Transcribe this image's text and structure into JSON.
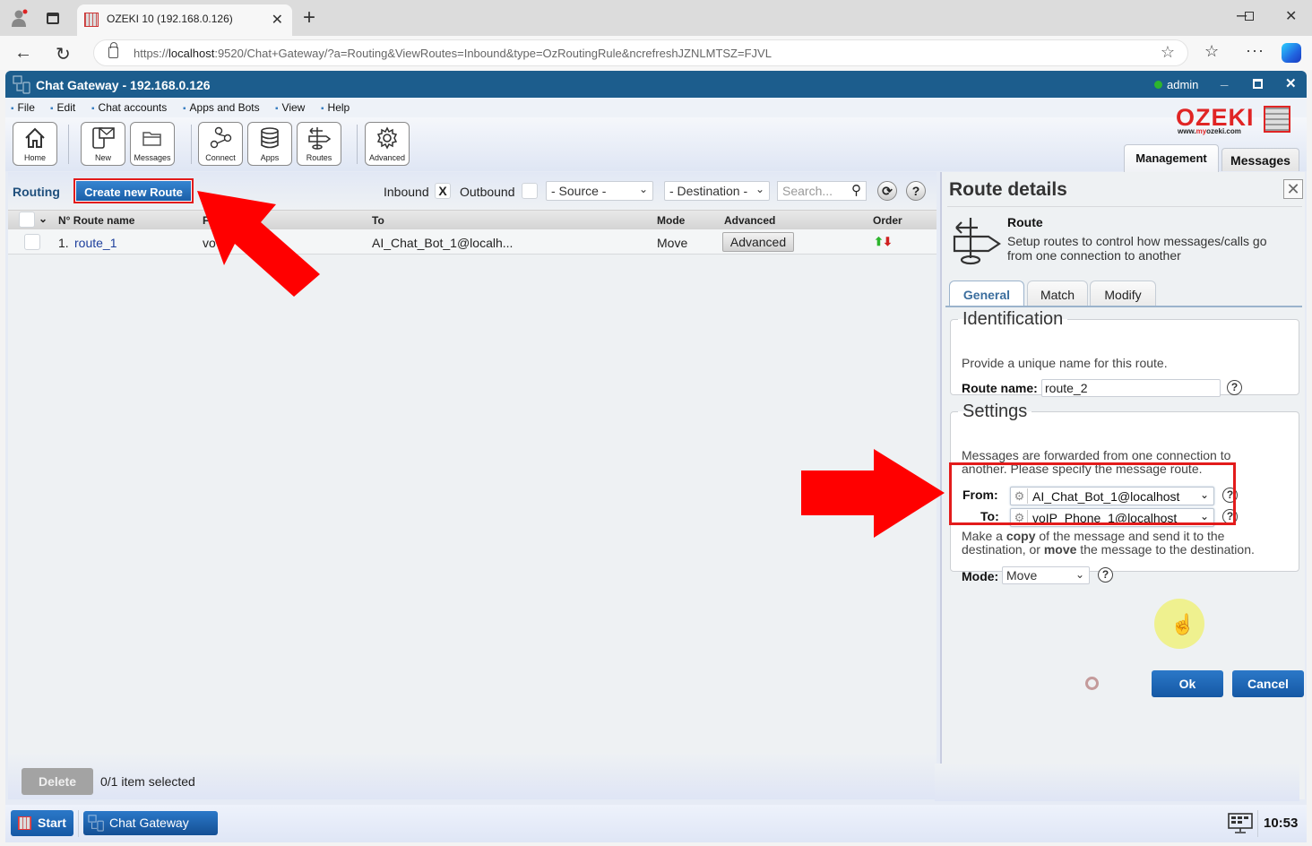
{
  "browser": {
    "tab_title": "OZEKI 10 (192.168.0.126)",
    "url_prefix": "https://",
    "url_host": "localhost",
    "url_rest": ":9520/Chat+Gateway/?a=Routing&ViewRoutes=Inbound&type=OzRoutingRule&ncrefreshJZNLMTSZ=FJVL"
  },
  "app": {
    "title": "Chat Gateway - 192.168.0.126",
    "user": "admin",
    "menu": [
      "File",
      "Edit",
      "Chat accounts",
      "Apps and Bots",
      "View",
      "Help"
    ],
    "toolbar": [
      "Home",
      "New",
      "Messages",
      "Connect",
      "Apps",
      "Routes",
      "Advanced"
    ],
    "logo_word": "OZEKI",
    "logo_url_pre": "www.",
    "logo_url_my": "my",
    "logo_url_post": "ozeki.com",
    "main_tabs": [
      "Management",
      "Messages"
    ]
  },
  "routing": {
    "label": "Routing",
    "create_button": "Create new Route",
    "filter_inbound": "Inbound",
    "filter_inbound_checked": "X",
    "filter_outbound": "Outbound",
    "source_select": "- Source -",
    "destination_select": "- Destination -",
    "search_placeholder": "Search...",
    "columns": [
      "N° Route name",
      "From",
      "To",
      "Mode",
      "Advanced",
      "Order"
    ],
    "rows": [
      {
        "num": "1.",
        "name": "route_1",
        "from": "vo",
        "to": "AI_Chat_Bot_1@localh...",
        "mode": "Move",
        "advanced": "Advanced"
      }
    ],
    "delete_button": "Delete",
    "selection_status": "0/1 item selected"
  },
  "details": {
    "title": "Route details",
    "heading": "Route",
    "description": "Setup routes to control how messages/calls go from one connection to another",
    "tabs": [
      "General",
      "Match",
      "Modify"
    ],
    "identification": {
      "legend": "Identification",
      "hint": "Provide a unique name for this route.",
      "route_name_label": "Route name:",
      "route_name_value": "route_2"
    },
    "settings": {
      "legend": "Settings",
      "hint": "Messages are forwarded from one connection to another. Please specify the message route.",
      "from_label": "From:",
      "from_value": "AI_Chat_Bot_1@localhost",
      "to_label": "To:",
      "to_value": "voIP_Phone_1@localhost",
      "mode_hint_1": "Make a ",
      "mode_hint_copy": "copy",
      "mode_hint_2": " of the message and send it to the destination, or ",
      "mode_hint_move": "move",
      "mode_hint_3": " the message to the destination.",
      "mode_label": "Mode:",
      "mode_value": "Move"
    },
    "ok_button": "Ok",
    "cancel_button": "Cancel"
  },
  "taskbar": {
    "start": "Start",
    "task": "Chat Gateway",
    "clock": "10:53"
  },
  "icons": {
    "help": "?",
    "chevron": "⌄",
    "gear": "⚙"
  },
  "colors": {
    "titlebar": "#1c5d8d",
    "accent_button": "#1b5fa8",
    "highlight_red": "#e31b1b",
    "link": "#1d3f9c"
  }
}
